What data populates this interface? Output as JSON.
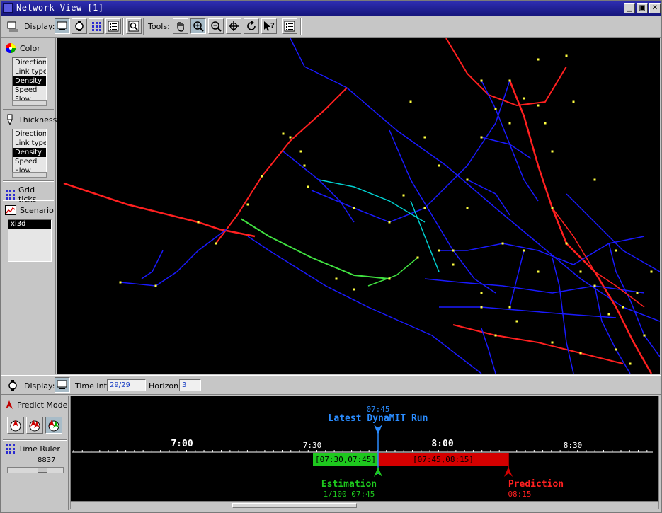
{
  "window": {
    "title": "Network View [1]"
  },
  "toolbar": {
    "display_label": "Display:",
    "tools_label": "Tools:",
    "icons": [
      "display-icon",
      "watch-icon",
      "grid-icon",
      "list-icon",
      "zoom-box-icon",
      "hand-icon",
      "zoom-in-icon",
      "zoom-out-icon",
      "center-icon",
      "rotate-icon",
      "help-pointer-icon",
      "info-list-icon"
    ]
  },
  "left_panel": {
    "color": {
      "label": "Color",
      "items": [
        "Direction",
        "Link type",
        "Density",
        "Speed",
        "Flow"
      ],
      "selected": "Density"
    },
    "thickness": {
      "label": "Thickness",
      "items": [
        "Direction",
        "Link type",
        "Density",
        "Speed",
        "Flow"
      ],
      "selected": "Density"
    },
    "grid_ticks_label": "Grid ticks",
    "scenario": {
      "label": "Scenario",
      "items": [
        "xi3d"
      ],
      "selected": "xi3d"
    }
  },
  "status": {
    "display_label": "Display:",
    "time_int_label": "Time Int.:",
    "time_int_value": "29/29",
    "horizon_label": "Horizon:",
    "horizon_value": "3"
  },
  "bottom_left": {
    "predict_mode_label": "Predict Mode",
    "time_ruler_label": "Time Ruler",
    "time_ruler_value": "8837"
  },
  "timeline": {
    "latest_time": "07:45",
    "latest_label": "Latest DynaMIT Run",
    "ticks_major": [
      "7:00",
      "8:00"
    ],
    "ticks_minor": [
      "7:30",
      "8:30"
    ],
    "estimation_range": "[07:30,07:45]",
    "prediction_range": "[07:45,08:15]",
    "estimation_label": "Estimation",
    "estimation_detail": "1/100  07:45",
    "prediction_label": "Prediction",
    "prediction_detail": "08:15",
    "colors": {
      "estimation": "#1ec81e",
      "prediction": "#d40000",
      "latest": "#2a8cff",
      "ruler": "#ffffff"
    }
  },
  "map_colors": {
    "low": "#1a1aff",
    "mid": "#00d0d0",
    "green": "#40e040",
    "high": "#ff2020",
    "node": "#ffff40"
  }
}
